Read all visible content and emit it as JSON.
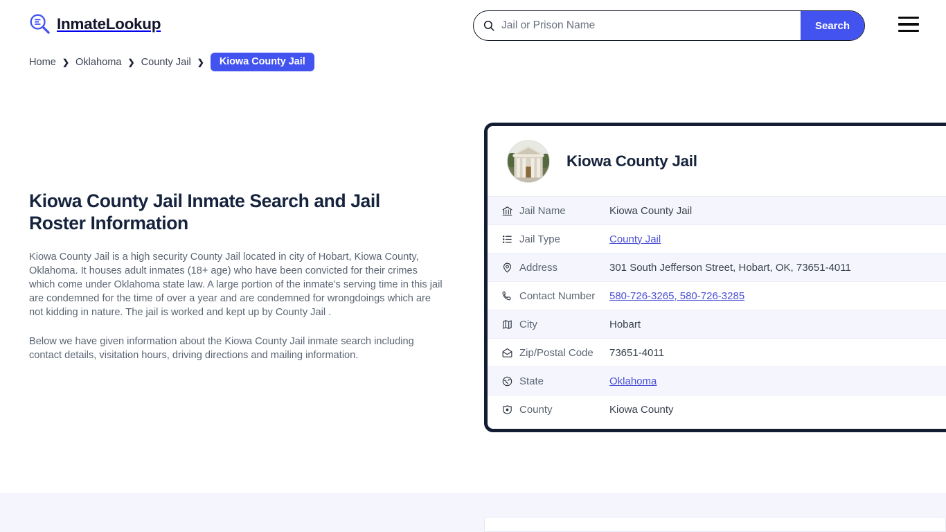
{
  "header": {
    "brand_name": "InmateLookup",
    "brand_icon": "magnifier-list-logo-icon",
    "search": {
      "placeholder": "Jail or Prison Name",
      "value": "",
      "button_label": "Search",
      "icon": "search-icon"
    },
    "menu_icon": "hamburger-menu-icon",
    "accent_color": "#4353f0"
  },
  "breadcrumb": {
    "items": [
      {
        "label": "Home",
        "current": false
      },
      {
        "label": "Oklahoma",
        "current": false
      },
      {
        "label": "County Jail",
        "current": false
      },
      {
        "label": "Kiowa County Jail",
        "current": true
      }
    ],
    "separator": "❯",
    "current_bg": "#4353f0"
  },
  "main": {
    "title": "Kiowa County Jail Inmate Search and Jail Roster Information",
    "paragraph_1": "Kiowa County Jail is a high security County Jail located in city of Hobart, Kiowa County, Oklahoma. It houses adult inmates (18+ age) who have been convicted for their crimes which come under Oklahoma state law. A large portion of the inmate's serving time in this jail are condemned for the time of over a year and are condemned for wrongdoings which are not kidding in nature. The jail is worked and kept up by County Jail .",
    "paragraph_2": "Below we have given information about the Kiowa County Jail inmate search including contact details, visitation hours, driving directions and mailing information."
  },
  "card": {
    "photo_alt": "kiowa-county-courthouse-photo",
    "title": "Kiowa County Jail",
    "border_color": "#131c33",
    "rows": [
      {
        "icon": "bank-building-icon",
        "label": "Jail Name",
        "value": "Kiowa County Jail",
        "link": false
      },
      {
        "icon": "list-icon",
        "label": "Jail Type",
        "value": "County Jail",
        "link": true
      },
      {
        "icon": "map-pin-icon",
        "label": "Address",
        "value": "301 South Jefferson Street, Hobart, OK, 73651-4011",
        "link": false
      },
      {
        "icon": "phone-icon",
        "label": "Contact Number",
        "value": "580-726-3265, 580-726-3285",
        "link": true
      },
      {
        "icon": "map-icon",
        "label": "City",
        "value": "Hobart",
        "link": false
      },
      {
        "icon": "envelope-open-icon",
        "label": "Zip/Postal Code",
        "value": "73651-4011",
        "link": false
      },
      {
        "icon": "globe-icon",
        "label": "State",
        "value": "Oklahoma",
        "link": true
      },
      {
        "icon": "shield-badge-icon",
        "label": "County",
        "value": "Kiowa County",
        "link": false
      }
    ]
  }
}
